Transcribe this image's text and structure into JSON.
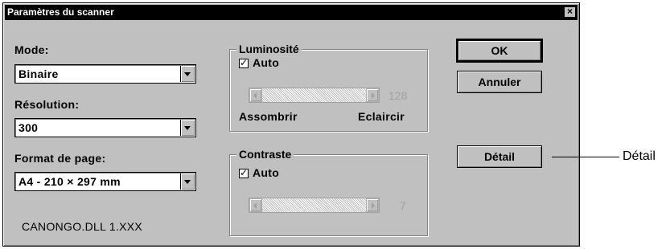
{
  "window": {
    "title": "Paramètres du scanner",
    "close_label": "×"
  },
  "mode": {
    "label": "Mode:",
    "value": "Binaire"
  },
  "resolution": {
    "label": "Résolution:",
    "value": "300"
  },
  "page_format": {
    "label": "Format de page:",
    "value": "A4 - 210 × 297 mm"
  },
  "dll_version": "CANONGO.DLL 1.XXX",
  "brightness": {
    "title": "Luminosité",
    "auto_label": "Auto",
    "auto_checked": true,
    "value": "128",
    "min_label": "Assombrir",
    "max_label": "Eclaircir"
  },
  "contrast": {
    "title": "Contraste",
    "auto_label": "Auto",
    "auto_checked": true,
    "value": "7"
  },
  "buttons": {
    "ok": "OK",
    "cancel": "Annuler",
    "detail": "Détail"
  },
  "callout": {
    "detail": "Détail"
  },
  "colors": {
    "dialog_bg": "#c0c0c0",
    "titlebar_bg": "#000000",
    "disabled_text": "#a0a0a0"
  }
}
